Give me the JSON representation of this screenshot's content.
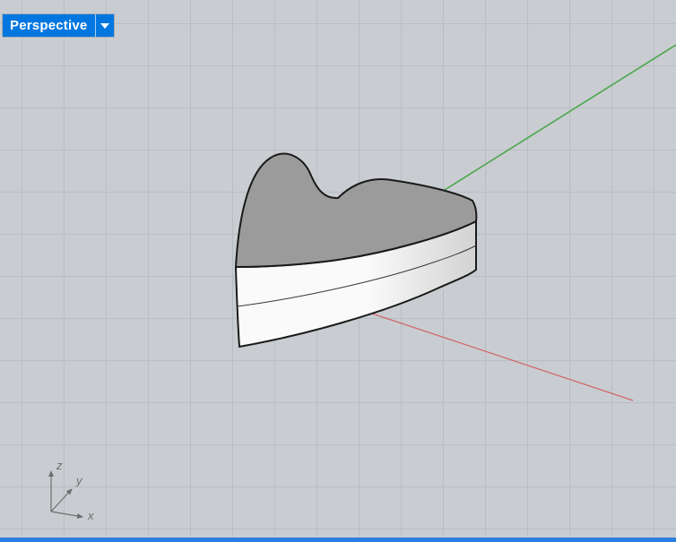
{
  "viewport": {
    "title": "Perspective",
    "dropdown_icon": "chevron-down-icon",
    "view_type": "3d-perspective"
  },
  "scene": {
    "object_name": "heart-shaped-extrusion"
  },
  "gizmo": {
    "x_label": "x",
    "y_label": "y",
    "z_label": "z"
  },
  "colors": {
    "viewport_bg": "#c9cdd1",
    "grid_line": "#b9bec3",
    "title_bg": "#0077e0",
    "title_text": "#ffffff",
    "axis_x": "#d06a6a",
    "axis_y": "#4ca64c",
    "heart_top": "#9b9b9b",
    "heart_side_light": "#fafafa",
    "heart_side_dark": "#d2d2d2",
    "outline": "#1a1a1a",
    "seam": "#3a3a3a",
    "gizmo": "#6e6e6e",
    "bottom_border": "#2a7de1"
  }
}
